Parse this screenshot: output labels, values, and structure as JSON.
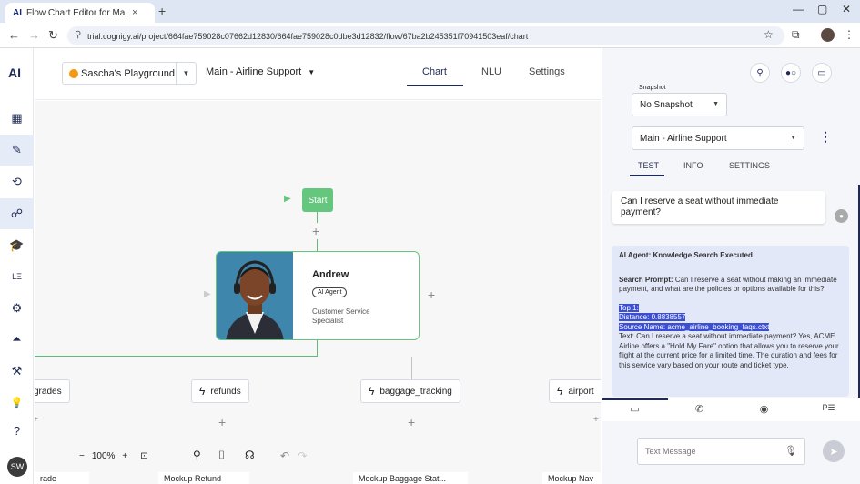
{
  "browser": {
    "tab_logo": "AI",
    "tab_title": "Flow Chart Editor for Main - AI",
    "tab_close": "×",
    "new_tab": "+",
    "url": "trial.cognigy.ai/project/664fae759028c07662d12830/664fae759028c0dbe3d12832/flow/67ba2b245351f70941503eaf/chart"
  },
  "leftnav": {
    "logo": "AI",
    "items": [
      {
        "icon": "dashboard-icon",
        "glyph": "▦"
      },
      {
        "icon": "build-icon",
        "glyph": "✎"
      },
      {
        "icon": "flow-icon",
        "glyph": "⟲"
      },
      {
        "icon": "agents-icon",
        "glyph": "☍"
      },
      {
        "icon": "learn-icon",
        "glyph": "🎓"
      },
      {
        "icon": "lexicon-icon",
        "glyph": "LΞ"
      },
      {
        "icon": "integrations-icon",
        "glyph": "⚙"
      },
      {
        "icon": "deploy-icon",
        "glyph": "⏶"
      },
      {
        "icon": "tools-icon",
        "glyph": "⚒"
      },
      {
        "icon": "ideas-icon",
        "glyph": "💡"
      },
      {
        "icon": "help-icon",
        "glyph": "?"
      }
    ],
    "user_initials": "SW"
  },
  "header": {
    "project": "Sascha's Playground",
    "flow": "Main - Airline Support",
    "tabs": [
      "Chart",
      "NLU",
      "Settings"
    ]
  },
  "canvas": {
    "start_label": "Start",
    "agent": {
      "name": "Andrew",
      "badge": "AI Agent",
      "role": "Customer Service Specialist"
    },
    "nodes": [
      "grades",
      "refunds",
      "baggage_tracking",
      "airport"
    ],
    "bottom_labels": [
      "rade",
      "Mockup Refund",
      "Mockup Baggage Stat...",
      "Mockup Nav"
    ],
    "zoom": "100%"
  },
  "panel": {
    "snapshot_label": "Snapshot",
    "snapshot_value": "No Snapshot",
    "flow_value": "Main - Airline Support",
    "tabs": [
      "TEST",
      "INFO",
      "SETTINGS"
    ],
    "user_message": "Can I reserve a seat without immediate payment?",
    "bot_header": "AI Agent: Knowledge Search Executed",
    "search_prompt_label": "Search Prompt:",
    "search_prompt": "Can I reserve a seat without making an immediate payment, and what are the policies or options available for this?",
    "top_label": "Top 1:",
    "distance": "Distance: 0.8838557",
    "source": "Source Name: acme_airline_booking_faqs.ctxt",
    "text_body": "Text: Can I reserve a seat without immediate payment? Yes, ACME Airline offers a \"Hold My Fare\" option that allows you to reserve your flight at the current price for a limited time. The duration and fees for this service vary based on your route and ticket type.",
    "input_placeholder": "Text Message"
  },
  "colors": {
    "accent": "#1e2a55",
    "start_green": "#65c77e",
    "project_dot": "#f29a18",
    "bot_bubble": "#e3e8f9",
    "highlight": "#3b4fd0"
  }
}
